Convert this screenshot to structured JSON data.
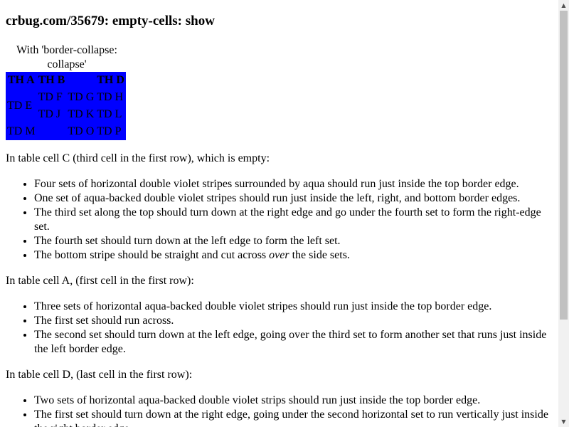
{
  "page": {
    "title": "crbug.com/35679: empty-cells: show",
    "caption": "With 'border-collapse: collapse'"
  },
  "table": {
    "header": [
      "TH A",
      "TH B",
      "",
      "TH D"
    ],
    "row2": {
      "e": "TD E",
      "f": "TD F",
      "g": "TD G",
      "h": "TD H"
    },
    "row3": {
      "j": "TD J",
      "k": "TD K",
      "l": "TD L"
    },
    "row4": {
      "m": "TD M",
      "o": "TD O",
      "p": "TD P"
    },
    "background_color": "#0000ff"
  },
  "sections": [
    {
      "intro": "In table cell C (third cell in the first row), which is empty:",
      "items": [
        "Four sets of horizontal double violet stripes surrounded by aqua should run just inside the top border edge.",
        "One set of aqua-backed double violet stripes should run just inside the left, right, and bottom border edges.",
        "The third set along the top should turn down at the right edge and go under the fourth set to form the right-edge set.",
        "The fourth set should turn down at the left edge to form the left set.",
        {
          "before": "The bottom stripe should be straight and cut across ",
          "em": "over",
          "after": " the side sets."
        }
      ]
    },
    {
      "intro": "In table cell A, (first cell in the first row):",
      "items": [
        "Three sets of horizontal aqua-backed double violet stripes should run just inside the top border edge.",
        "The first set should run across.",
        "The second set should turn down at the left edge, going over the third set to form another set that runs just inside the left border edge."
      ]
    },
    {
      "intro": "In table cell D, (last cell in the first row):",
      "items": [
        "Two sets of horizontal aqua-backed double violet strips should run just inside the top border edge.",
        "The first set should turn down at the right edge, going under the second horizontal set to run vertically just inside the right border edge."
      ]
    }
  ],
  "scrollbar": {
    "up_icon": "▲",
    "down_icon": "▼"
  }
}
